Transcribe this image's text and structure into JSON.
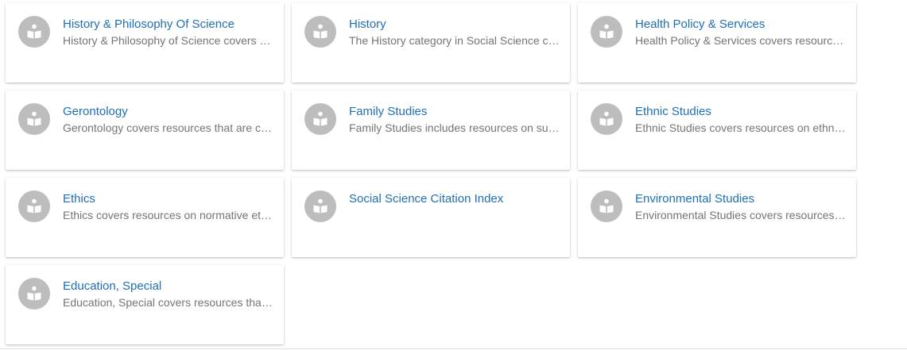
{
  "icon": "book-reader-icon",
  "colors": {
    "title": "#1e6fb5",
    "description": "#757575",
    "avatar": "#bdbdbd"
  },
  "cards": [
    {
      "title": "History & Philosophy Of Science",
      "description": "History & Philosophy of Science covers resources on the history and philosophy of science"
    },
    {
      "title": "History",
      "description": "The History category in Social Science covers resources on history"
    },
    {
      "title": "Health Policy & Services",
      "description": "Health Policy & Services covers resources on health policy and services"
    },
    {
      "title": "Gerontology",
      "description": "Gerontology covers resources that are concerned with aging"
    },
    {
      "title": "Family Studies",
      "description": "Family Studies includes resources on subjects related to the family"
    },
    {
      "title": "Ethnic Studies",
      "description": "Ethnic Studies covers resources on ethnic groups"
    },
    {
      "title": "Ethics",
      "description": "Ethics covers resources on normative ethics"
    },
    {
      "title": "Social Science Citation Index",
      "description": ""
    },
    {
      "title": "Environmental Studies",
      "description": "Environmental Studies covers resources on the environment"
    },
    {
      "title": "Education, Special",
      "description": "Education, Special covers resources that deal with special education"
    }
  ]
}
